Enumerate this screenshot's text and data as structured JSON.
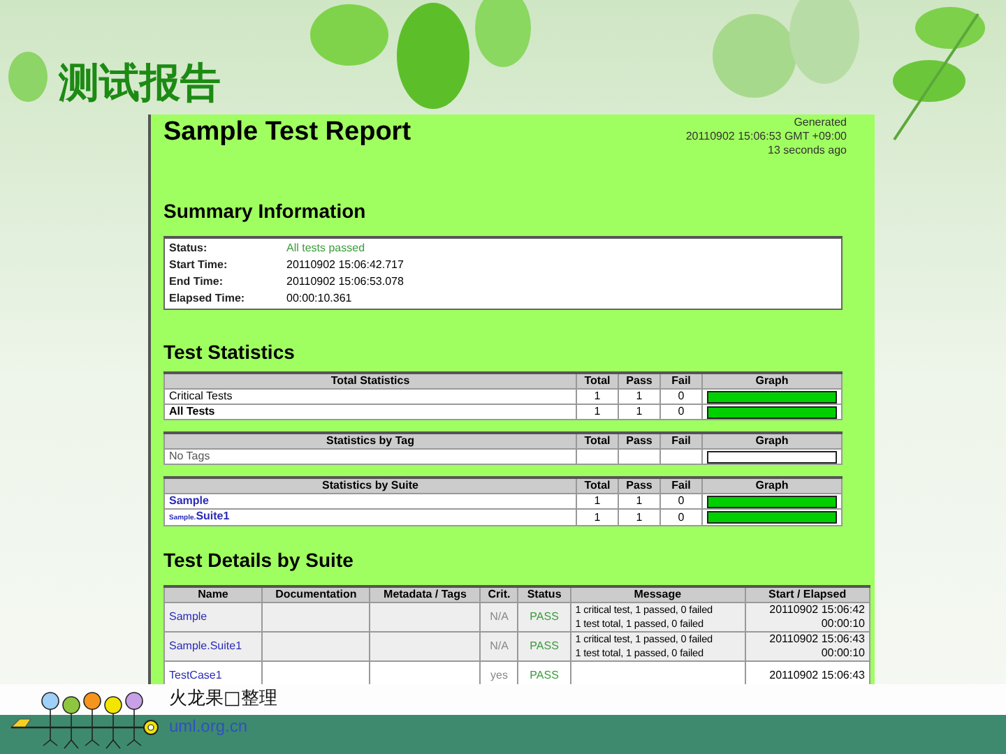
{
  "slide_title": "测试报告",
  "report": {
    "title": "Sample Test Report",
    "generated": [
      "Generated",
      "20110902 15:06:53 GMT +09:00",
      "13 seconds ago"
    ],
    "summary": {
      "heading": "Summary Information",
      "rows": [
        {
          "label": "Status:",
          "value": "All tests passed",
          "kind": "status"
        },
        {
          "label": "Start Time:",
          "value": "20110902 15:06:42.717",
          "kind": "plain"
        },
        {
          "label": "End Time:",
          "value": "20110902 15:06:53.078",
          "kind": "plain"
        },
        {
          "label": "Elapsed Time:",
          "value": "00:00:10.361",
          "kind": "plain"
        }
      ]
    },
    "statistics": {
      "heading": "Test Statistics",
      "tables": [
        {
          "columns": [
            "Total Statistics",
            "Total",
            "Pass",
            "Fail",
            "Graph"
          ],
          "rows": [
            {
              "name": "Critical Tests",
              "kind": "plain",
              "total": "1",
              "pass": "1",
              "fail": "0",
              "level": 1
            },
            {
              "name": "All Tests",
              "kind": "bold",
              "total": "1",
              "pass": "1",
              "fail": "0",
              "level": 1
            }
          ]
        },
        {
          "columns": [
            "Statistics by Tag",
            "Total",
            "Pass",
            "Fail",
            "Graph"
          ],
          "rows": [
            {
              "name": "No Tags",
              "kind": "empty"
            }
          ]
        },
        {
          "columns": [
            "Statistics by Suite",
            "Total",
            "Pass",
            "Fail",
            "Graph"
          ],
          "rows": [
            {
              "name": "Sample",
              "kind": "link",
              "total": "1",
              "pass": "1",
              "fail": "0",
              "level": 1
            },
            {
              "parent": "Sample.",
              "name": "Suite1",
              "kind": "link",
              "total": "1",
              "pass": "1",
              "fail": "0",
              "level": 1
            }
          ]
        }
      ]
    },
    "details": {
      "heading": "Test Details by Suite",
      "columns": [
        "Name",
        "Documentation",
        "Metadata / Tags",
        "Crit.",
        "Status",
        "Message",
        "Start / Elapsed"
      ],
      "rows": [
        {
          "name": "Sample",
          "kind": "suite",
          "crit": "N/A",
          "status": "PASS",
          "message": [
            "1 critical test, 1 passed, 0 failed",
            "1 test total, 1 passed, 0 failed"
          ],
          "start": "20110902 15:06:42",
          "elapsed": "00:00:10"
        },
        {
          "name": "Sample.Suite1",
          "kind": "suite",
          "crit": "N/A",
          "status": "PASS",
          "message": [
            "1 critical test, 1 passed, 0 failed",
            "1 test total, 1 passed, 0 failed"
          ],
          "start": "20110902 15:06:43",
          "elapsed": "00:00:10"
        },
        {
          "name": "TestCase1",
          "kind": "test",
          "crit": "yes",
          "status": "PASS",
          "start": "20110902 15:06:43"
        }
      ]
    }
  },
  "footer": {
    "credit": "火龙果□整理",
    "site": "uml.org.cn"
  }
}
